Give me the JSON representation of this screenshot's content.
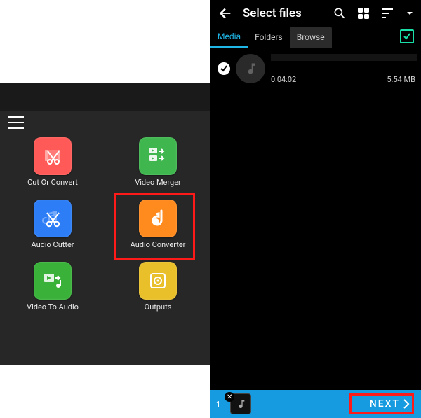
{
  "left": {
    "items": [
      {
        "label": "Cut Or Convert",
        "color": "#ff5a57"
      },
      {
        "label": "Video Merger",
        "color": "#3fb64e"
      },
      {
        "label": "Audio Cutter",
        "color": "#2d7df6"
      },
      {
        "label": "Audio Converter",
        "color": "#ff8b1f"
      },
      {
        "label": "Video To Audio",
        "color": "#3ab23a"
      },
      {
        "label": "Outputs",
        "color": "#e9c02a"
      }
    ]
  },
  "right": {
    "title": "Select files",
    "tabs": {
      "media": "Media",
      "folders": "Folders",
      "browse": "Browse"
    },
    "file": {
      "duration": "0:04:02",
      "size": "5.54 MB"
    },
    "footer": {
      "count": "1",
      "next": "NEXT"
    }
  }
}
